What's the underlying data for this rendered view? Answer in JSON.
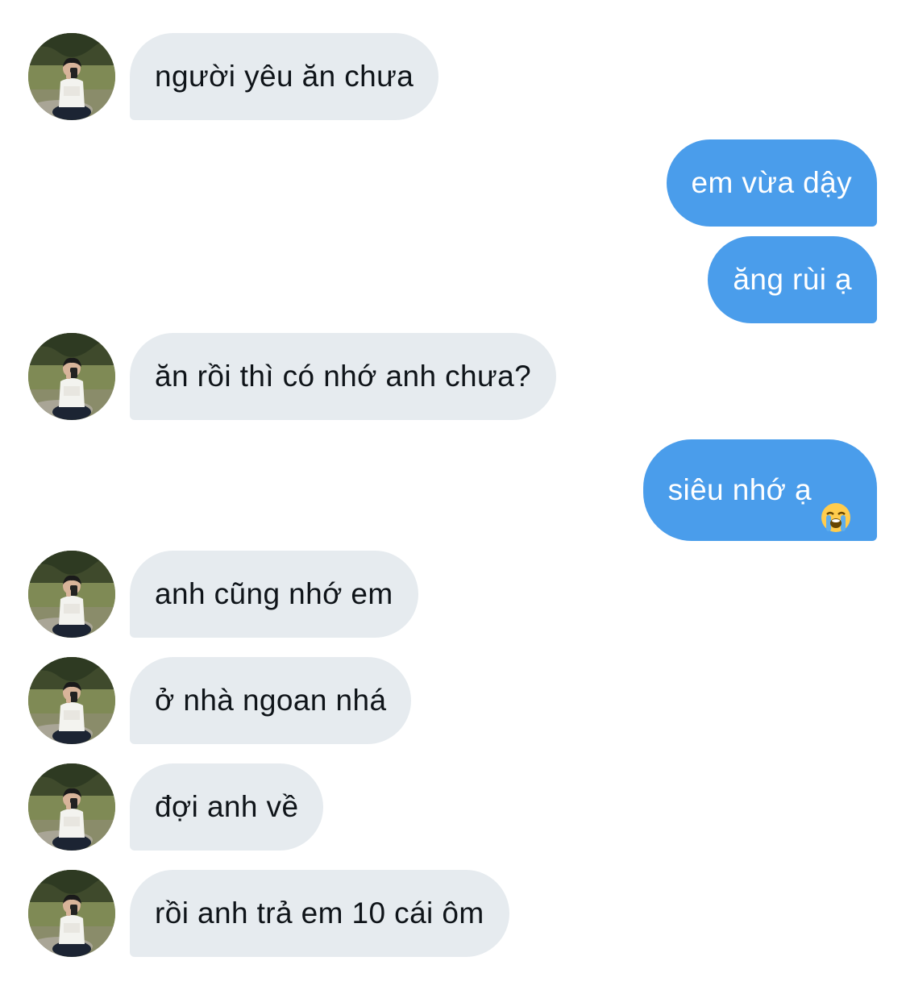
{
  "conversation": {
    "messages": [
      {
        "side": "in",
        "text": "người yêu ăn chưa"
      },
      {
        "side": "out",
        "text": "em vừa dậy"
      },
      {
        "side": "out",
        "text": "ăng rùi ạ"
      },
      {
        "side": "in",
        "text": "ăn rồi thì có nhớ anh chưa?"
      },
      {
        "side": "out",
        "text": "siêu nhớ ạ",
        "emoji": "loudly-crying-face-icon"
      },
      {
        "side": "in",
        "text": "anh cũng nhớ em"
      },
      {
        "side": "in",
        "text": "ở nhà ngoan nhá"
      },
      {
        "side": "in",
        "text": "đợi anh về"
      },
      {
        "side": "in",
        "text": "rồi anh trả em 10 cái ôm"
      }
    ]
  },
  "colors": {
    "incoming_bubble": "#e6ebef",
    "outgoing_bubble": "#4a9deb",
    "incoming_text": "#0f1419",
    "outgoing_text": "#ffffff"
  }
}
